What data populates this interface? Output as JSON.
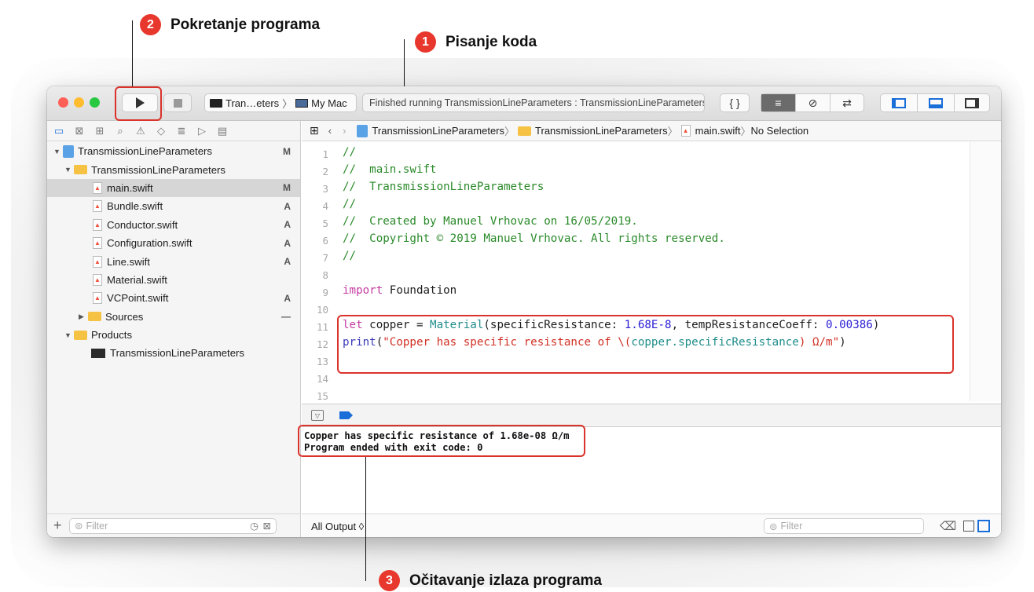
{
  "annotations": [
    {
      "number": "2",
      "label": "Pokretanje programa"
    },
    {
      "number": "1",
      "label": "Pisanje koda"
    },
    {
      "number": "3",
      "label": "Očitavanje izlaza programa"
    }
  ],
  "toolbar": {
    "run_icon": "play-icon",
    "stop_icon": "stop-icon",
    "scheme": "Tran…eters",
    "scheme_sep": "〉",
    "destination": "My Mac",
    "activity": "Finished running TransmissionLineParameters : TransmissionLineParameters",
    "code_review_icon": "{ }",
    "editor_modes": [
      "≡",
      "⊘",
      "⇄"
    ],
    "panel_toggles": [
      "left-panel-icon",
      "bottom-panel-icon",
      "right-panel-icon"
    ]
  },
  "navigator": {
    "tabs": [
      "folder-icon",
      "source-control-icon",
      "symbol-icon",
      "search-icon",
      "warning-icon",
      "test-icon",
      "debug-icon",
      "breakpoint-icon",
      "report-icon"
    ],
    "tree": [
      {
        "label": "TransmissionLineParameters",
        "badge": "M",
        "kind": "project",
        "level": 0,
        "expanded": true
      },
      {
        "label": "TransmissionLineParameters",
        "badge": "",
        "kind": "folder",
        "level": 1,
        "expanded": true
      },
      {
        "label": "main.swift",
        "badge": "M",
        "kind": "swift",
        "level": 2,
        "selected": true
      },
      {
        "label": "Bundle.swift",
        "badge": "A",
        "kind": "swift",
        "level": 2
      },
      {
        "label": "Conductor.swift",
        "badge": "A",
        "kind": "swift",
        "level": 2
      },
      {
        "label": "Configuration.swift",
        "badge": "A",
        "kind": "swift",
        "level": 2
      },
      {
        "label": "Line.swift",
        "badge": "A",
        "kind": "swift",
        "level": 2
      },
      {
        "label": "Material.swift",
        "badge": "",
        "kind": "swift",
        "level": 2
      },
      {
        "label": "VCPoint.swift",
        "badge": "A",
        "kind": "swift",
        "level": 2
      },
      {
        "label": "Sources",
        "badge": "—",
        "kind": "folder",
        "level": 1,
        "expanded": false
      },
      {
        "label": "Products",
        "badge": "",
        "kind": "folder",
        "level": 0,
        "expanded": true
      },
      {
        "label": "TransmissionLineParameters",
        "badge": "",
        "kind": "exe",
        "level": 1
      }
    ],
    "add_label": "+",
    "filter_placeholder": "Filter"
  },
  "jumpbar": {
    "crumbs": [
      "TransmissionLineParameters",
      "TransmissionLineParameters",
      "main.swift",
      "No Selection"
    ],
    "sep": "〉"
  },
  "editor": {
    "line_numbers": [
      "1",
      "2",
      "3",
      "4",
      "5",
      "6",
      "7",
      "8",
      "9",
      "10",
      "11",
      "12",
      "13",
      "14",
      "15"
    ],
    "lines": [
      "//",
      "//  main.swift",
      "//  TransmissionLineParameters",
      "//",
      "//  Created by Manuel Vrhovac on 16/05/2019.",
      "//  Copyright © 2019 Manuel Vrhovac. All rights reserved.",
      "//",
      "",
      "import Foundation",
      "",
      "let copper = Material(specificResistance: 1.68E-8, tempResistanceCoeff: 0.00386)",
      "print(\"Copper has specific resistance of \\(copper.specificResistance) Ω/m\")",
      "",
      "",
      ""
    ]
  },
  "console": {
    "lines": [
      "Copper has specific resistance of 1.68e-08 Ω/m",
      "Program ended with exit code: 0"
    ],
    "scope": "All Output ◊",
    "filter_placeholder": "Filter"
  },
  "colors": {
    "accent_red": "#e8372c",
    "highlight_box": "#d9332b",
    "comment": "#2a8a2a",
    "keyword": "#c43ca0",
    "string": "#d13025",
    "number": "#2a1cd4"
  }
}
